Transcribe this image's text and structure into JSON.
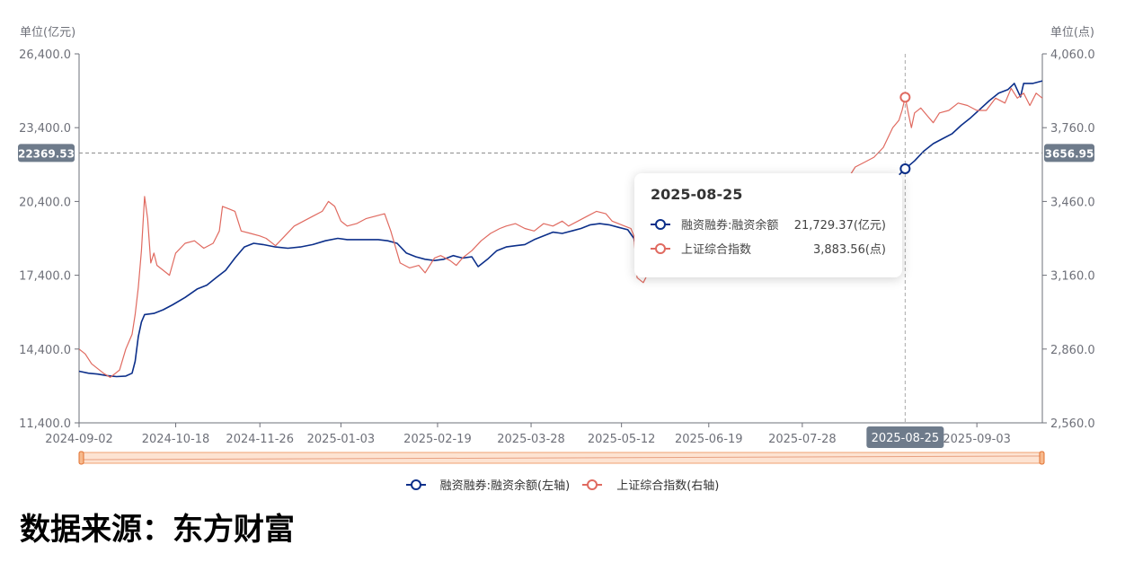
{
  "chart_data": {
    "type": "line",
    "left_unit": "单位(亿元)",
    "right_unit": "单位(点)",
    "left_ticks": [
      "26,400.0",
      "23,400.0",
      "20,400.0",
      "17,400.0",
      "14,400.0",
      "11,400.0"
    ],
    "right_ticks": [
      "4,060.0",
      "3,760.0",
      "3,460.0",
      "3,160.0",
      "2,860.0",
      "2,560.0"
    ],
    "x_ticks": [
      "2024-09-02",
      "2024-10-18",
      "2024-11-26",
      "2025-01-03",
      "2025-02-19",
      "2025-03-28",
      "2025-05-12",
      "2025-06-19",
      "2025-07-28",
      "2025-09-03"
    ],
    "y_left_range": [
      11400,
      26400
    ],
    "y_right_range": [
      2560,
      4060
    ],
    "colors": {
      "margin": "#0c2f8a",
      "index": "#e06a60"
    },
    "series": [
      {
        "name": "融资融券:融资余额(左轴)",
        "axis": "left",
        "color": "#0c2f8a",
        "points": [
          [
            0,
            13500
          ],
          [
            3,
            13420
          ],
          [
            6,
            13380
          ],
          [
            9,
            13320
          ],
          [
            12,
            13280
          ],
          [
            15,
            13300
          ],
          [
            17,
            13420
          ],
          [
            18,
            13900
          ],
          [
            19,
            14900
          ],
          [
            20,
            15500
          ],
          [
            21,
            15800
          ],
          [
            24,
            15850
          ],
          [
            27,
            16000
          ],
          [
            30,
            16200
          ],
          [
            34,
            16500
          ],
          [
            38,
            16850
          ],
          [
            41,
            17000
          ],
          [
            44,
            17300
          ],
          [
            47,
            17600
          ],
          [
            50,
            18100
          ],
          [
            53,
            18550
          ],
          [
            56,
            18700
          ],
          [
            59,
            18650
          ],
          [
            63,
            18550
          ],
          [
            67,
            18500
          ],
          [
            71,
            18550
          ],
          [
            75,
            18650
          ],
          [
            79,
            18800
          ],
          [
            83,
            18900
          ],
          [
            86,
            18850
          ],
          [
            90,
            18850
          ],
          [
            93,
            18850
          ],
          [
            96,
            18850
          ],
          [
            99,
            18800
          ],
          [
            102,
            18700
          ],
          [
            105,
            18300
          ],
          [
            108,
            18150
          ],
          [
            111,
            18050
          ],
          [
            114,
            18000
          ],
          [
            117,
            18050
          ],
          [
            120,
            18200
          ],
          [
            123,
            18100
          ],
          [
            126,
            18150
          ],
          [
            128,
            17750
          ],
          [
            131,
            18050
          ],
          [
            134,
            18400
          ],
          [
            137,
            18550
          ],
          [
            140,
            18600
          ],
          [
            143,
            18650
          ],
          [
            146,
            18850
          ],
          [
            149,
            19000
          ],
          [
            152,
            19150
          ],
          [
            155,
            19100
          ],
          [
            158,
            19200
          ],
          [
            161,
            19300
          ],
          [
            164,
            19450
          ],
          [
            167,
            19500
          ],
          [
            170,
            19450
          ],
          [
            173,
            19350
          ],
          [
            176,
            19250
          ],
          [
            178,
            18900
          ],
          [
            179,
            18250
          ],
          [
            181,
            18100
          ],
          [
            184,
            18050
          ],
          [
            187,
            18000
          ],
          [
            190,
            18050
          ],
          [
            193,
            17950
          ],
          [
            196,
            17900
          ],
          [
            199,
            17950
          ],
          [
            202,
            18050
          ],
          [
            205,
            18100
          ],
          [
            208,
            18150
          ],
          [
            211,
            18100
          ],
          [
            214,
            18250
          ],
          [
            217,
            18400
          ],
          [
            220,
            18550
          ],
          [
            223,
            18700
          ],
          [
            226,
            18850
          ],
          [
            229,
            18900
          ],
          [
            232,
            19050
          ],
          [
            235,
            19200
          ],
          [
            238,
            19450
          ],
          [
            241,
            19800
          ],
          [
            244,
            20000
          ],
          [
            247,
            20250
          ],
          [
            250,
            20400
          ],
          [
            253,
            20700
          ],
          [
            256,
            20950
          ],
          [
            259,
            21200
          ],
          [
            262,
            21350
          ],
          [
            265,
            21729.37
          ],
          [
            268,
            22050
          ],
          [
            271,
            22450
          ],
          [
            274,
            22750
          ],
          [
            277,
            22950
          ],
          [
            280,
            23150
          ],
          [
            283,
            23500
          ],
          [
            286,
            23800
          ],
          [
            289,
            24150
          ],
          [
            292,
            24500
          ],
          [
            295,
            24800
          ],
          [
            298,
            24950
          ],
          [
            300,
            25200
          ],
          [
            302,
            24650
          ],
          [
            303,
            25200
          ],
          [
            306,
            25200
          ],
          [
            309,
            25300
          ]
        ]
      },
      {
        "name": "上证综合指数(右轴)",
        "axis": "right",
        "color": "#e06a60",
        "points": [
          [
            0,
            2860
          ],
          [
            2,
            2840
          ],
          [
            4,
            2800
          ],
          [
            6,
            2780
          ],
          [
            8,
            2760
          ],
          [
            10,
            2745
          ],
          [
            11,
            2755
          ],
          [
            13,
            2775
          ],
          [
            15,
            2860
          ],
          [
            17,
            2920
          ],
          [
            18,
            3000
          ],
          [
            19,
            3110
          ],
          [
            20,
            3260
          ],
          [
            21,
            3480
          ],
          [
            22,
            3390
          ],
          [
            23,
            3210
          ],
          [
            24,
            3250
          ],
          [
            25,
            3200
          ],
          [
            27,
            3180
          ],
          [
            29,
            3160
          ],
          [
            31,
            3250
          ],
          [
            34,
            3290
          ],
          [
            37,
            3300
          ],
          [
            40,
            3270
          ],
          [
            43,
            3290
          ],
          [
            45,
            3340
          ],
          [
            46,
            3440
          ],
          [
            48,
            3430
          ],
          [
            50,
            3420
          ],
          [
            52,
            3340
          ],
          [
            55,
            3330
          ],
          [
            58,
            3320
          ],
          [
            60,
            3310
          ],
          [
            63,
            3280
          ],
          [
            66,
            3320
          ],
          [
            69,
            3360
          ],
          [
            72,
            3380
          ],
          [
            75,
            3400
          ],
          [
            78,
            3420
          ],
          [
            80,
            3460
          ],
          [
            82,
            3440
          ],
          [
            84,
            3380
          ],
          [
            86,
            3360
          ],
          [
            89,
            3370
          ],
          [
            92,
            3390
          ],
          [
            95,
            3400
          ],
          [
            98,
            3410
          ],
          [
            100,
            3340
          ],
          [
            103,
            3210
          ],
          [
            106,
            3190
          ],
          [
            109,
            3200
          ],
          [
            111,
            3170
          ],
          [
            114,
            3230
          ],
          [
            116,
            3240
          ],
          [
            119,
            3220
          ],
          [
            121,
            3200
          ],
          [
            123,
            3230
          ],
          [
            126,
            3260
          ],
          [
            129,
            3300
          ],
          [
            132,
            3330
          ],
          [
            135,
            3350
          ],
          [
            137,
            3360
          ],
          [
            140,
            3370
          ],
          [
            143,
            3350
          ],
          [
            146,
            3340
          ],
          [
            149,
            3370
          ],
          [
            152,
            3360
          ],
          [
            155,
            3380
          ],
          [
            157,
            3360
          ],
          [
            160,
            3380
          ],
          [
            163,
            3400
          ],
          [
            166,
            3420
          ],
          [
            169,
            3410
          ],
          [
            171,
            3380
          ],
          [
            173,
            3370
          ],
          [
            175,
            3360
          ],
          [
            177,
            3350
          ],
          [
            178,
            3320
          ],
          [
            179,
            3150
          ],
          [
            181,
            3130
          ],
          [
            183,
            3180
          ],
          [
            186,
            3220
          ],
          [
            189,
            3240
          ],
          [
            192,
            3270
          ],
          [
            195,
            3280
          ],
          [
            198,
            3290
          ],
          [
            201,
            3290
          ],
          [
            204,
            3300
          ],
          [
            207,
            3300
          ],
          [
            210,
            3330
          ],
          [
            213,
            3340
          ],
          [
            216,
            3360
          ],
          [
            219,
            3370
          ],
          [
            222,
            3380
          ],
          [
            225,
            3390
          ],
          [
            228,
            3410
          ],
          [
            231,
            3430
          ],
          [
            234,
            3460
          ],
          [
            237,
            3490
          ],
          [
            240,
            3510
          ],
          [
            243,
            3520
          ],
          [
            246,
            3540
          ],
          [
            249,
            3600
          ],
          [
            252,
            3620
          ],
          [
            255,
            3640
          ],
          [
            258,
            3680
          ],
          [
            261,
            3760
          ],
          [
            263,
            3790
          ],
          [
            264,
            3830
          ],
          [
            265,
            3883.56
          ],
          [
            266,
            3820
          ],
          [
            267,
            3760
          ],
          [
            268,
            3820
          ],
          [
            270,
            3840
          ],
          [
            272,
            3810
          ],
          [
            274,
            3780
          ],
          [
            276,
            3820
          ],
          [
            279,
            3830
          ],
          [
            282,
            3860
          ],
          [
            285,
            3850
          ],
          [
            288,
            3830
          ],
          [
            291,
            3830
          ],
          [
            294,
            3880
          ],
          [
            297,
            3860
          ],
          [
            299,
            3920
          ],
          [
            301,
            3880
          ],
          [
            303,
            3900
          ],
          [
            305,
            3850
          ],
          [
            307,
            3900
          ],
          [
            309,
            3880
          ]
        ]
      }
    ],
    "x_index_max": 309,
    "x_tick_indices": [
      0,
      31,
      58,
      84,
      115,
      145,
      174,
      202,
      232,
      288
    ],
    "crosshair": {
      "left_value": "22369.53",
      "right_value": "3656.95",
      "x_label": "2025-08-25",
      "index": 265
    }
  },
  "tooltip": {
    "date": "2025-08-25",
    "rows": [
      {
        "name": "融资融券:融资余额",
        "value": "21,729.37(亿元)"
      },
      {
        "name": "上证综合指数",
        "value": "3,883.56(点)"
      }
    ]
  },
  "legend": [
    "融资融券:融资余额(左轴)",
    "上证综合指数(右轴)"
  ],
  "source": "数据来源：东方财富"
}
